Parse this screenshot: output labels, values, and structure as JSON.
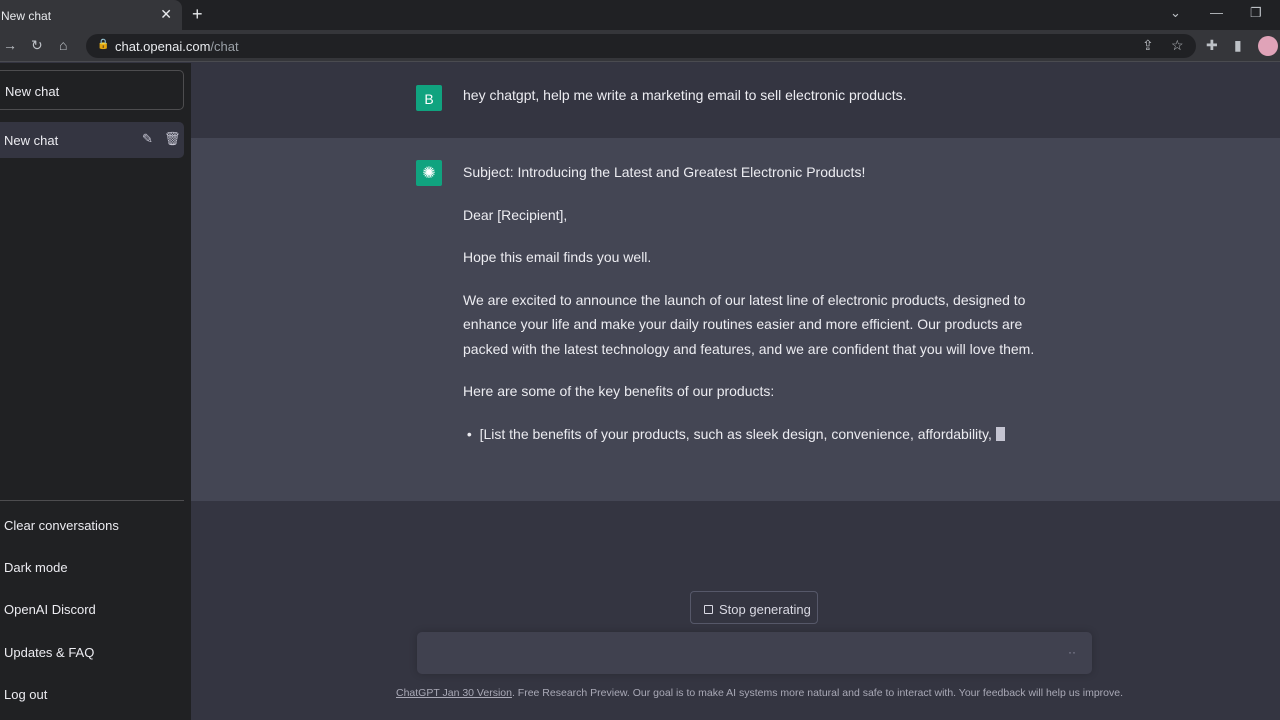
{
  "browser": {
    "tab_title": "New chat",
    "url_host": "chat.openai.com",
    "url_path": "/chat"
  },
  "sidebar": {
    "new_chat": "New chat",
    "chats": [
      {
        "title": "New chat"
      }
    ],
    "links": [
      "Clear conversations",
      "Dark mode",
      "OpenAI Discord",
      "Updates & FAQ",
      "Log out"
    ]
  },
  "conversation": {
    "user_avatar": "B",
    "user_avatar_color": "#10a37f",
    "user_message": "hey chatgpt, help me write a marketing email to sell electronic products.",
    "assistant_paragraphs": [
      "Subject: Introducing the Latest and Greatest Electronic Products!",
      "Dear [Recipient],",
      "Hope this email finds you well.",
      "We are excited to announce the launch of our latest line of electronic products, designed to enhance your life and make your daily routines easier and more efficient. Our products are packed with the latest technology and features, and we are confident that you will love them.",
      "Here are some of the key benefits of our products:"
    ],
    "assistant_bullet": "[List the benefits of your products, such as sleek design, convenience, affordability,"
  },
  "composer": {
    "stop_label": "Stop generating",
    "typing_indicator": "··"
  },
  "footer": {
    "version_link": "ChatGPT Jan 30 Version",
    "text": ". Free Research Preview. Our goal is to make AI systems more natural and safe to interact with. Your feedback will help us improve."
  }
}
